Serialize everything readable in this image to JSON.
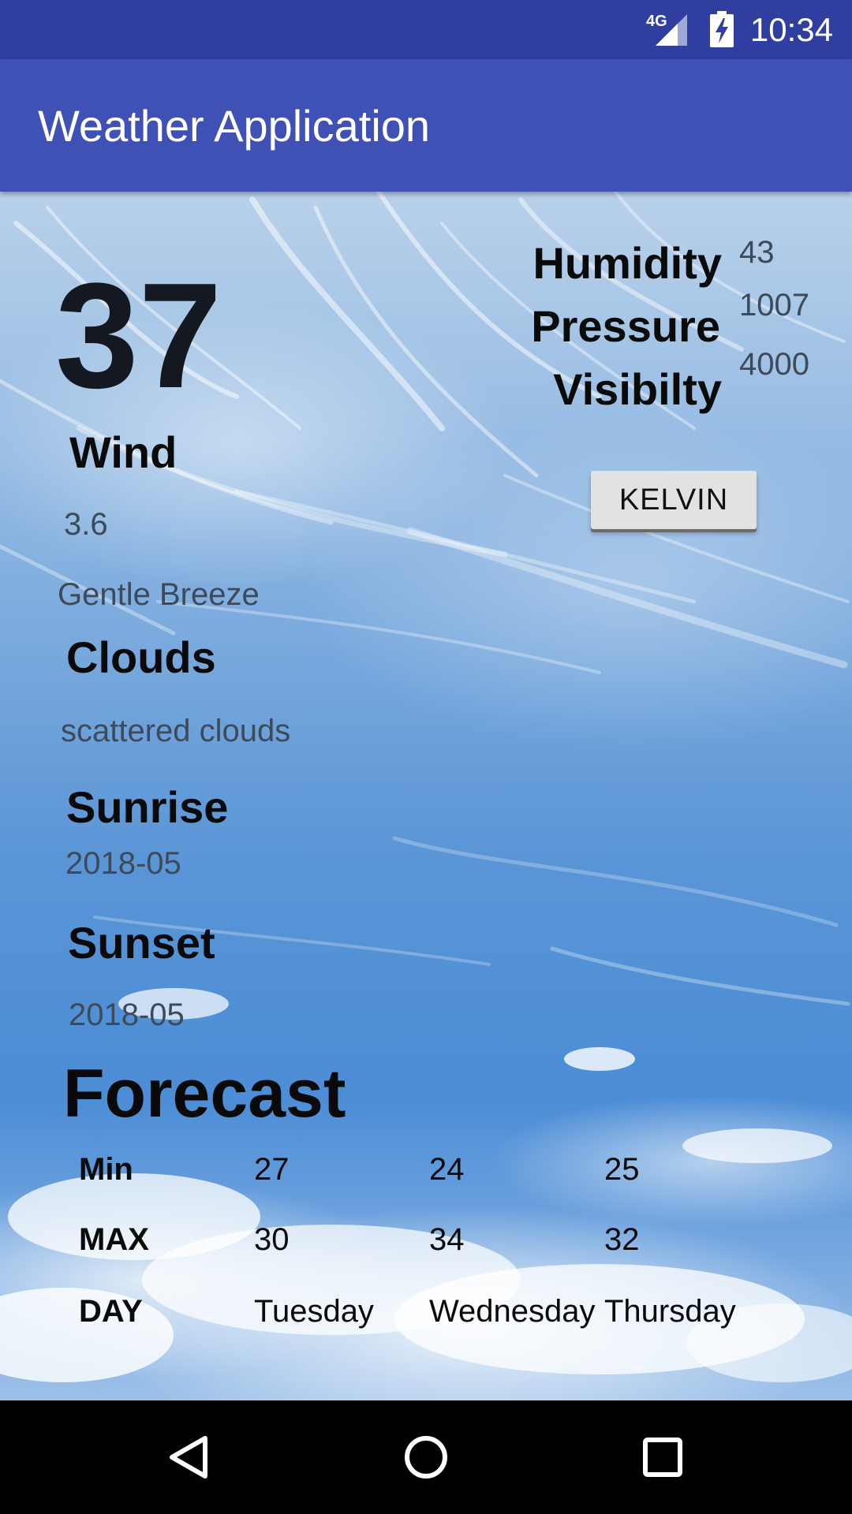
{
  "status_bar": {
    "network": "4G",
    "time": "10:34",
    "icons": [
      "signal-icon",
      "battery-charging-icon"
    ]
  },
  "app_bar": {
    "title": "Weather Application"
  },
  "current": {
    "temperature": "37",
    "wind_label": "Wind",
    "wind_value": "3.6",
    "wind_description": "Gentle Breeze",
    "clouds_label": "Clouds",
    "clouds_value": "scattered clouds",
    "sunrise_label": "Sunrise",
    "sunrise_value": "2018-05",
    "sunset_label": "Sunset",
    "sunset_value": "2018-05"
  },
  "stats": {
    "humidity_label": "Humidity",
    "humidity_value": "43",
    "pressure_label": "Pressure",
    "pressure_value": "1007",
    "visibility_label": "Visibilty",
    "visibility_value": "4000"
  },
  "unit_button": {
    "label": "KELVIN"
  },
  "forecast": {
    "title": "Forecast",
    "rows": [
      {
        "label": "Min",
        "values": [
          "27",
          "24",
          "25"
        ]
      },
      {
        "label": "MAX",
        "values": [
          "30",
          "34",
          "32"
        ]
      },
      {
        "label": "DAY",
        "values": [
          "Tuesday",
          "Wednesday",
          "Thursday"
        ]
      }
    ]
  },
  "nav_bar": {
    "icons": [
      "back-icon",
      "home-icon",
      "recents-icon"
    ]
  }
}
